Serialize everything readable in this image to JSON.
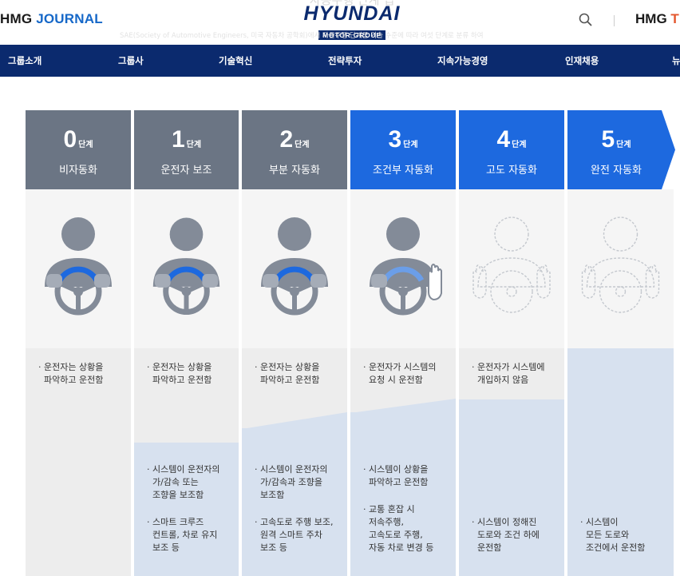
{
  "header": {
    "brand_left_prefix": "HMG",
    "brand_left_suffix": "JOURNAL",
    "logo_ghost": "자동주행 단계 맵",
    "logo_main": "HYUNDAI",
    "logo_sub": "MOTOR GROUP",
    "subtitle_ghost": "SAE(Society of Automotive Engineers, 미국 자동차 공학회)에서 자율주행 단계를 기술 수준에 따라 여섯 단계로 분류 하여",
    "brand_right_prefix": "HMG",
    "brand_right_suffix": "T"
  },
  "nav": [
    "그룹소개",
    "그룹사",
    "기술혁신",
    "전략투자",
    "지속가능경영",
    "인재채용",
    "뉴"
  ],
  "levels": [
    {
      "num": "0",
      "unit": "단계",
      "name": "비자동화",
      "driver": "· 운전자는 상황을\n  파악하고 운전함",
      "system": []
    },
    {
      "num": "1",
      "unit": "단계",
      "name": "운전자 보조",
      "driver": "· 운전자는 상황을\n  파악하고 운전함",
      "system": [
        "· 시스템이 운전자의\n  가/감속 또는\n  조향을 보조함",
        "· 스마트 크루즈\n  컨트롤, 차로 유지\n  보조 등"
      ]
    },
    {
      "num": "2",
      "unit": "단계",
      "name": "부분 자동화",
      "driver": "· 운전자는 상황을\n  파악하고 운전함",
      "system": [
        "· 시스템이 운전자의\n  가/감속과 조향을\n  보조함",
        "· 고속도로 주행 보조,\n  원격 스마트 주차\n  보조 등"
      ]
    },
    {
      "num": "3",
      "unit": "단계",
      "name": "조건부 자동화",
      "driver": "· 운전자가 시스템의\n  요청 시 운전함",
      "system": [
        "· 시스템이 상황을\n  파악하고 운전함",
        "· 교통 혼잡 시\n  저속주행,\n  고속도로 주행,\n  자동 차로 변경 등"
      ]
    },
    {
      "num": "4",
      "unit": "단계",
      "name": "고도 자동화",
      "driver": "· 운전자가 시스템에\n  개입하지 않음",
      "system": [
        "· 시스템이 정해진\n  도로와 조건 하에\n  운전함"
      ]
    },
    {
      "num": "5",
      "unit": "단계",
      "name": "완전 자동화",
      "driver": "",
      "system": [
        "· 시스템이\n  모든 도로와\n  조건에서 운전함"
      ]
    }
  ],
  "colors": {
    "nav": "#0b2a6e",
    "gray_stage": "#6b7584",
    "blue_stage": "#1d69df",
    "system_bg": "#d7e1ef",
    "driver_bg": "#ededed"
  }
}
